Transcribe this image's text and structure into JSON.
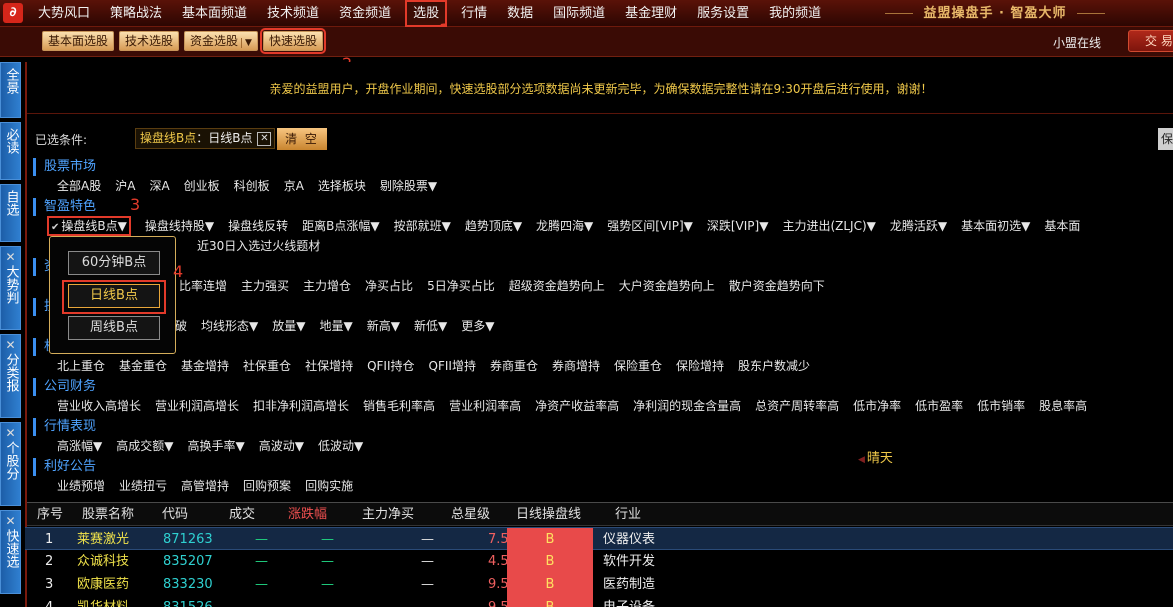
{
  "menubar": {
    "logo_icon": "app-logo-icon",
    "items": [
      "大势风口",
      "策略战法",
      "基本面频道",
      "技术频道",
      "资金频道",
      "选股",
      "行情",
      "数据",
      "国际频道",
      "基金理财",
      "服务设置",
      "我的频道"
    ],
    "active_index": 5,
    "brand": "益盟操盘手 · 智盈大师"
  },
  "subbar": {
    "buttons": [
      "基本面选股",
      "技术选股",
      "资金选股",
      "快速选股"
    ],
    "highlight_index": 3,
    "mini_online": "小盟在线",
    "trade_button": "交 易"
  },
  "vtabs": [
    {
      "label": "全景",
      "closable": false
    },
    {
      "label": "必读",
      "closable": false
    },
    {
      "label": "自选",
      "closable": false
    },
    {
      "label": "大势判",
      "closable": true
    },
    {
      "label": "分类报",
      "closable": true
    },
    {
      "label": "个股分",
      "closable": true
    },
    {
      "label": "快速选",
      "closable": true
    }
  ],
  "notice": "亲爱的益盟用户，开盘作业期间，快速选股部分选项数据尚未更新完毕，为确保数据完整性请在9:30开盘后进行使用，谢谢！",
  "conditions": {
    "label": "已选条件:",
    "tag_key": "操盘线B点",
    "tag_value": "：日线B点",
    "clear": "清 空",
    "save": "保"
  },
  "sections": {
    "market": {
      "title": "股票市场",
      "items": [
        "全部A股",
        "沪A",
        "深A",
        "创业板",
        "科创板",
        "京A",
        "选择板块",
        "剔除股票▼"
      ]
    },
    "feature": {
      "title": "智盈特色",
      "items": [
        "操盘线B点▼",
        "操盘线持股▼",
        "操盘线反转",
        "距离B点涨幅▼",
        "按部就班▼",
        "趋势顶底▼",
        "龙腾四海▼",
        "强势区间[VIP]▼",
        "深跌[VIP]▼",
        "主力进出(ZLJC)▼",
        "龙腾活跃▼",
        "基本面初选▼",
        "基本面"
      ],
      "extra": "近30日入选过火线题材"
    },
    "fund": {
      "title": "资金",
      "items": [
        "比率连增",
        "主力强买",
        "主力增仓",
        "净买占比",
        "5日净买占比",
        "超级资金趋势向上",
        "大户资金趋势向上",
        "散户资金趋势向下"
      ]
    },
    "tech": {
      "title": "技术",
      "items": [
        "破",
        "均线形态▼",
        "放量▼",
        "地量▼",
        "新高▼",
        "新低▼",
        "更多▼"
      ]
    },
    "inst": {
      "title": "机构",
      "items": [
        "北上重仓",
        "基金重仓",
        "基金增持",
        "社保重仓",
        "社保增持",
        "QFII持仓",
        "QFII增持",
        "券商重仓",
        "券商增持",
        "保险重仓",
        "保险增持",
        "股东户数减少"
      ]
    },
    "finance": {
      "title": "公司财务",
      "items": [
        "营业收入高增长",
        "营业利润高增长",
        "扣非净利润高增长",
        "销售毛利率高",
        "营业利润率高",
        "净资产收益率高",
        "净利润的现金含量高",
        "总资产周转率高",
        "低市净率",
        "低市盈率",
        "低市销率",
        "股息率高"
      ]
    },
    "quote": {
      "title": "行情表现",
      "items": [
        "高涨幅▼",
        "高成交额▼",
        "高换手率▼",
        "高波动▼",
        "低波动▼"
      ]
    },
    "good": {
      "title": "利好公告",
      "items": [
        "业绩预增",
        "业绩扭亏",
        "高管增持",
        "回购预案",
        "回购实施"
      ]
    }
  },
  "popup": {
    "options": [
      "60分钟B点",
      "日线B点",
      "周线B点"
    ],
    "selected_index": 1
  },
  "annotations": [
    "1",
    "2",
    "3",
    "4"
  ],
  "table": {
    "headers": [
      "序号",
      "股票名称",
      "代码",
      "成交",
      "涨跌幅",
      "主力净买",
      "总星级",
      "日线操盘线",
      "行业"
    ],
    "weather": "晴天",
    "rows": [
      {
        "idx": "1",
        "name": "莱赛激光",
        "code": "871263",
        "vol": "—",
        "chg": "—",
        "net": "—",
        "star": "7.5",
        "b": "B",
        "industry": "仪器仪表"
      },
      {
        "idx": "2",
        "name": "众诚科技",
        "code": "835207",
        "vol": "—",
        "chg": "—",
        "net": "—",
        "star": "4.5",
        "b": "B",
        "industry": "软件开发"
      },
      {
        "idx": "3",
        "name": "欧康医药",
        "code": "833230",
        "vol": "—",
        "chg": "—",
        "net": "—",
        "star": "9.5",
        "b": "B",
        "industry": "医药制造"
      },
      {
        "idx": "4",
        "name": "凯华材料",
        "code": "831526",
        "vol": "—",
        "chg": "—",
        "net": "—",
        "star": "9.5",
        "b": "B",
        "industry": "电子设备"
      }
    ]
  },
  "colors": {
    "accent_red": "#e23a2a",
    "brand_gold": "#e9b96a",
    "section_blue": "#4fa3ff",
    "highlight_yellow": "#f0c94a"
  }
}
